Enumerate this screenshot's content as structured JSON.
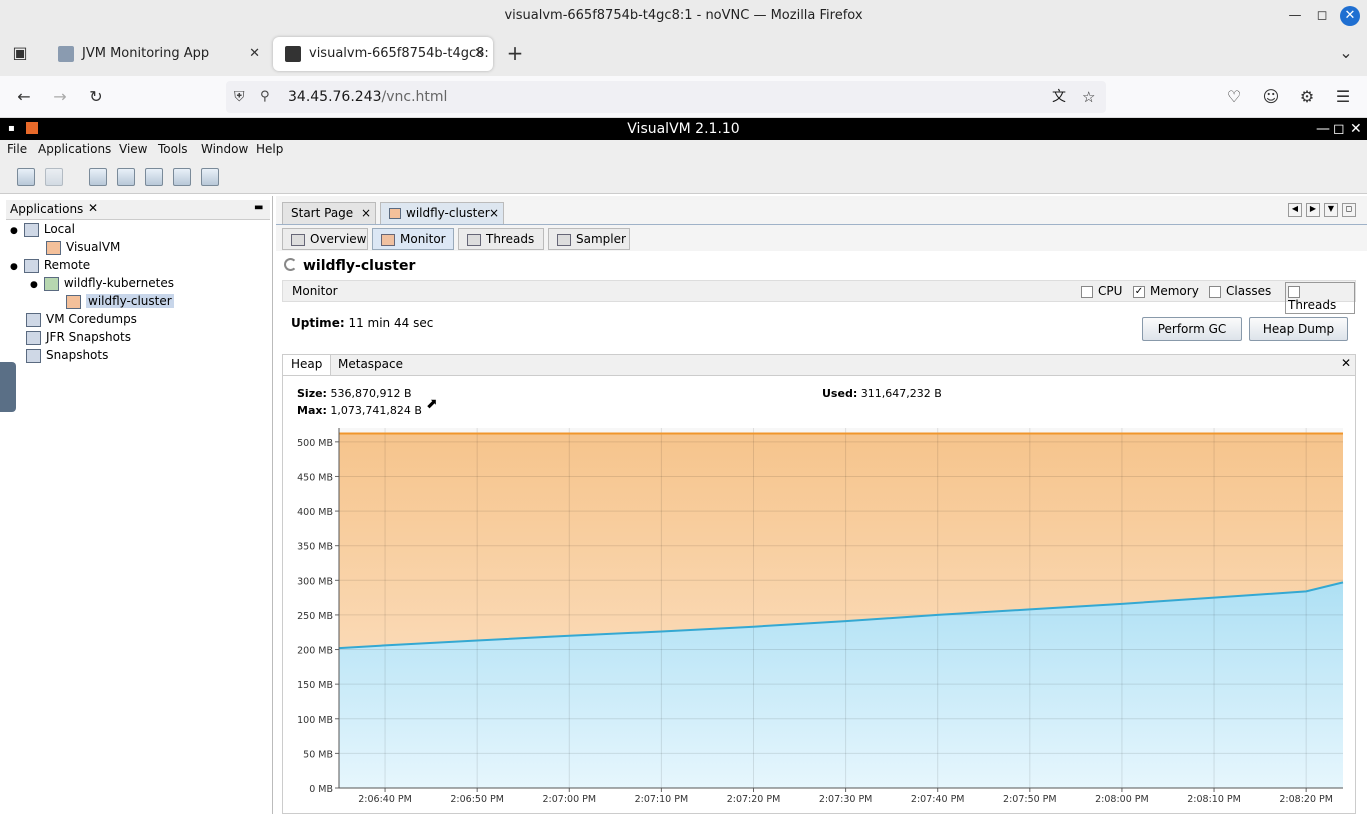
{
  "browser": {
    "window_title": "visualvm-665f8754b-t4gc8:1 - noVNC — Mozilla Firefox",
    "tabs": [
      {
        "label": "JVM Monitoring App"
      },
      {
        "label": "visualvm-665f8754b-t4gc8:"
      }
    ],
    "url_host": "34.45.76.243",
    "url_path": "/vnc.html"
  },
  "app": {
    "title": "VisualVM 2.1.10",
    "menu": [
      "File",
      "Applications",
      "View",
      "Tools",
      "Window",
      "Help"
    ],
    "left_panel": {
      "title": "Applications",
      "tree": [
        {
          "label": "Local"
        },
        {
          "label": "VisualVM"
        },
        {
          "label": "Remote"
        },
        {
          "label": "wildfly-kubernetes"
        },
        {
          "label": "wildfly-cluster"
        },
        {
          "label": "VM Coredumps"
        },
        {
          "label": "JFR Snapshots"
        },
        {
          "label": "Snapshots"
        }
      ]
    },
    "doc_tabs": [
      {
        "label": "Start Page"
      },
      {
        "label": "wildfly-cluster"
      }
    ],
    "sub_tabs": [
      {
        "label": "Overview"
      },
      {
        "label": "Monitor"
      },
      {
        "label": "Threads"
      },
      {
        "label": "Sampler"
      }
    ],
    "app_name": "wildfly-cluster",
    "monitor": {
      "label": "Monitor",
      "checkboxes": [
        {
          "label": "CPU",
          "checked": false
        },
        {
          "label": "Memory",
          "checked": true
        },
        {
          "label": "Classes",
          "checked": false
        },
        {
          "label": "Threads",
          "checked": false
        }
      ],
      "uptime_label": "Uptime:",
      "uptime_value": "11 min 44 sec",
      "perform_gc": "Perform GC",
      "heap_dump": "Heap Dump"
    },
    "heap_tabs": [
      {
        "label": "Heap"
      },
      {
        "label": "Metaspace"
      }
    ],
    "heap_stats": {
      "size_label": "Size:",
      "size_value": "536,870,912 B",
      "max_label": "Max:",
      "max_value": "1,073,741,824 B",
      "used_label": "Used:",
      "used_value": "311,647,232 B"
    }
  },
  "chart_data": {
    "type": "area",
    "y_unit": "MB",
    "ylim": [
      0,
      520
    ],
    "y_ticks": [
      "0 MB",
      "50 MB",
      "100 MB",
      "150 MB",
      "200 MB",
      "250 MB",
      "300 MB",
      "350 MB",
      "400 MB",
      "450 MB",
      "500 MB"
    ],
    "x_ticks": [
      "2:06:40 PM",
      "2:06:50 PM",
      "2:07:00 PM",
      "2:07:10 PM",
      "2:07:20 PM",
      "2:07:30 PM",
      "2:07:40 PM",
      "2:07:50 PM",
      "2:08:00 PM",
      "2:08:10 PM",
      "2:08:20 PM"
    ],
    "x_range_sec": [
      -5,
      104
    ],
    "series": [
      {
        "color": "#f0962c",
        "x": [
          -5,
          104
        ],
        "values": [
          512,
          512
        ]
      },
      {
        "color": "#34a8d2",
        "x": [
          -5,
          0,
          10,
          20,
          30,
          40,
          50,
          60,
          70,
          80,
          90,
          100,
          104
        ],
        "values": [
          202,
          206,
          213,
          220,
          226,
          233,
          241,
          250,
          258,
          266,
          275,
          284,
          297
        ]
      }
    ],
    "grid": true
  }
}
